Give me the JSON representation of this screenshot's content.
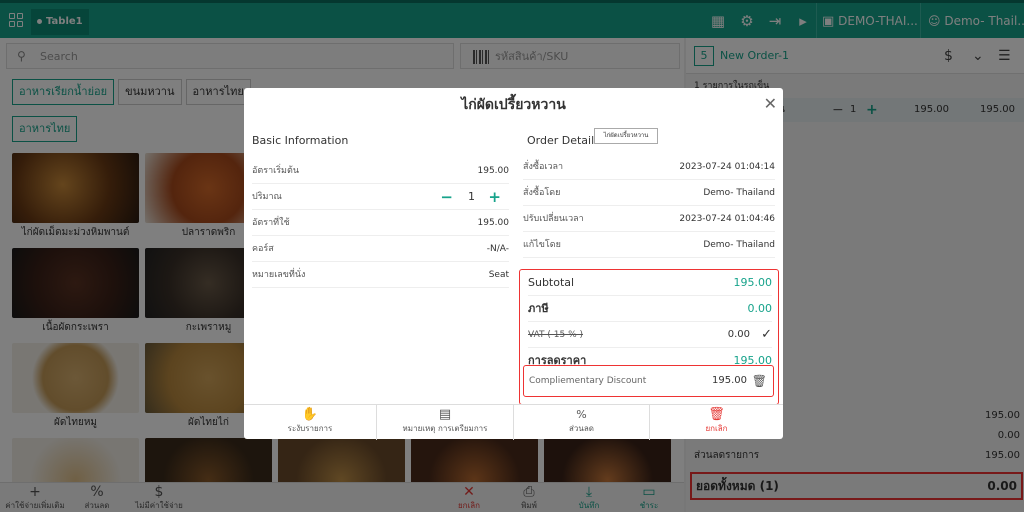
{
  "topbar": {
    "table_label": "Table1",
    "site_label": "DEMO-THAI...",
    "user_label": "Demo- Thail..."
  },
  "search": {
    "placeholder": "Search",
    "sku_placeholder": "รหัสสินค้า/SKU"
  },
  "categories_row1": [
    "อาหารเรียกน้ำย่อย",
    "ขนมหวาน",
    "อาหารไทย"
  ],
  "categories_row2": [
    "อาหารไทย"
  ],
  "menu_items": [
    {
      "name": "ไก่ผัดเม็ดมะม่วงหิมพานต์"
    },
    {
      "name": "ปลาราดพริก"
    },
    {
      "name": "เนื้อผัดกระเพรา"
    },
    {
      "name": "กะเพราหมู"
    },
    {
      "name": "ผัดไทยหมู"
    },
    {
      "name": "ผัดไทยไก่"
    }
  ],
  "bottom_bar": {
    "add": "ค่าใช้จ่ายเพิ่มเติม",
    "discount": "ส่วนลด",
    "no_tax": "ไม่มีค่าใช้จ่าย",
    "cancel": "ยกเลิก",
    "print": "พิมพ์",
    "save": "บันทึก",
    "pay": "ชำระ"
  },
  "order_panel": {
    "order_number": "5",
    "order_name": "New Order-1",
    "list_heading": "1 รายการในรถเข็น",
    "item_name": "น",
    "item_qty": "1",
    "item_price": "195.00",
    "item_total": "195.00",
    "sum_values": [
      "195.00",
      "0.00"
    ],
    "discount_label": "ส่วนลดรายการ",
    "discount_value": "195.00",
    "total_label": "ยอดทั้งหมด  (1)",
    "total_value": "0.00"
  },
  "modal": {
    "title": "ไก่ผัดเปรี้ยวหวาน",
    "basic_info_title": "Basic Information",
    "basic_rows": [
      {
        "label": "อัตราเริ่มต้น",
        "value": "195.00"
      },
      {
        "label": "ปริมาณ",
        "value": "1"
      },
      {
        "label": "อัตราที่ใช้",
        "value": "195.00"
      },
      {
        "label": "คอร์ส",
        "value": "-N/A-"
      },
      {
        "label": "หมายเลขที่นั่ง",
        "value": "Seat"
      }
    ],
    "order_details_title": "Order Details",
    "tooltip": "ไก่ผัดเปรี้ยวหวาน",
    "order_rows": [
      {
        "label": "สั่งซื้อเวลา",
        "value": "2023-07-24 01:04:14"
      },
      {
        "label": "สั่งซื้อโดย",
        "value": "Demo- Thailand"
      },
      {
        "label": "ปรับเปลี่ยนเวลา",
        "value": "2023-07-24 01:04:46"
      },
      {
        "label": "แก้ไขโดย",
        "value": "Demo- Thailand"
      }
    ],
    "summary": {
      "subtotal_label": "Subtotal",
      "subtotal_value": "195.00",
      "tax_label": "ภาษี",
      "tax_value": "0.00",
      "vat_label": "VAT ( 15 % )",
      "vat_value": "0.00",
      "discount_label": "การลดราคา",
      "discount_value": "195.00",
      "comp_label": "Compliementary Discount",
      "comp_value": "195.00"
    },
    "footer": {
      "hold": "ระงับรายการ",
      "prep_note": "หมายเหตุ การเตรียมการ",
      "discount": "ส่วนลด",
      "cancel": "ยกเลิก"
    }
  },
  "colors": {
    "accent": "#17a38b",
    "danger": "#e53935"
  }
}
